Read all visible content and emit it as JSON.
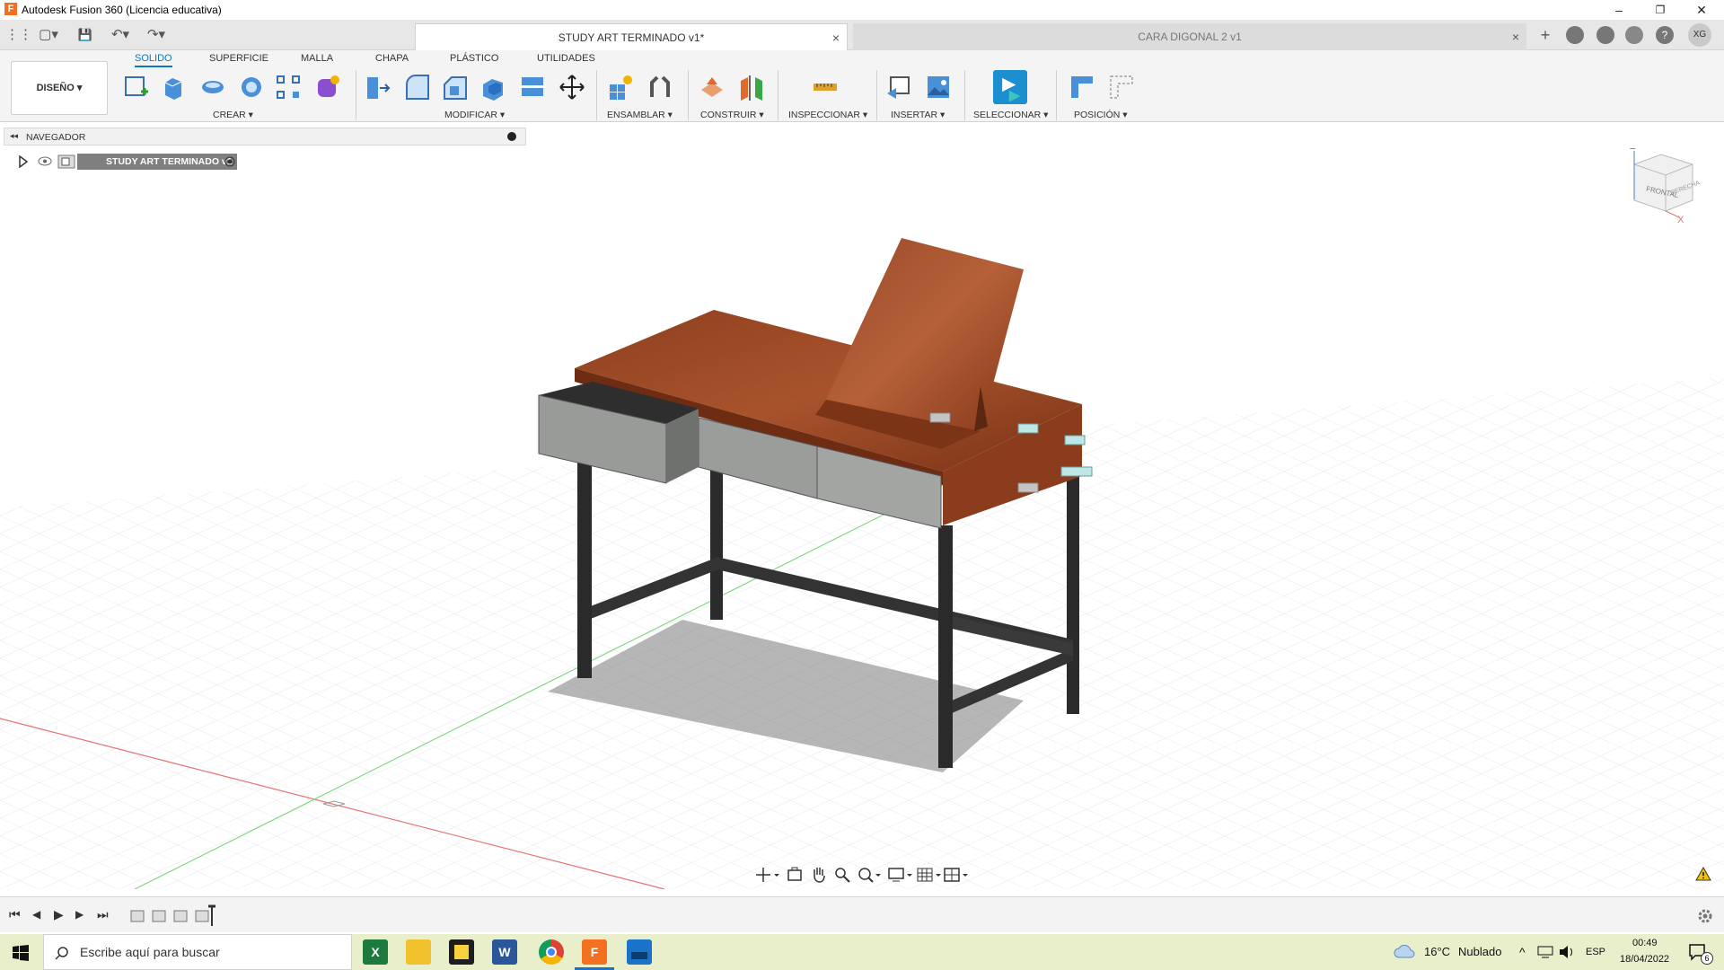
{
  "window": {
    "title": "Autodesk Fusion 360 (Licencia educativa)",
    "icon": "F",
    "minimize": "–",
    "restore": "❐",
    "close": "✕"
  },
  "quick_access": {
    "grid": "⋮⋮",
    "file": "▢▾",
    "save": "💾",
    "undo": "↶▾",
    "redo": "↷▾"
  },
  "document_tabs": [
    {
      "label": "STUDY ART TERMINADO v1*",
      "close": "×"
    },
    {
      "label": "CARA DIGONAL 2 v1",
      "close": "×"
    }
  ],
  "right_controls": {
    "add": "+",
    "user_initials": "XG"
  },
  "toolbar": {
    "workspace": "DISEÑO ▾",
    "tabs": [
      "SOLIDO",
      "SUPERFICIE",
      "MALLA",
      "CHAPA",
      "PLÁSTICO",
      "UTILIDADES"
    ],
    "groups": [
      "CREAR ▾",
      "MODIFICAR ▾",
      "ENSAMBLAR ▾",
      "CONSTRUIR ▾",
      "INSPECCIONAR ▾",
      "INSERTAR ▾",
      "SELECCIONAR ▾",
      "POSICIÓN ▾"
    ]
  },
  "browser": {
    "title": "NAVEGADOR",
    "collapse": "◂◂",
    "root_item": "STUDY ART TERMINADO v1"
  },
  "viewcube": {
    "top_axis": "Z",
    "side_axis": "X",
    "front": "FRONTAL",
    "right": "DERECHA"
  },
  "timeline": {
    "controls": [
      "⏮",
      "◀",
      "▶",
      "▶",
      "⏭"
    ]
  },
  "taskbar": {
    "search_placeholder": "Escribe aquí para buscar",
    "weather_temp": "16°C",
    "weather_text": "Nublado",
    "language": "ESP",
    "time": "00:49",
    "date": "18/04/2022",
    "notifications": "6"
  },
  "colors": {
    "accent": "#0a78c8",
    "wood": "#8b3a1e",
    "metal": "#2b2b2b",
    "drawer": "#a3a5a2",
    "taskbar": "#e9eecb"
  }
}
